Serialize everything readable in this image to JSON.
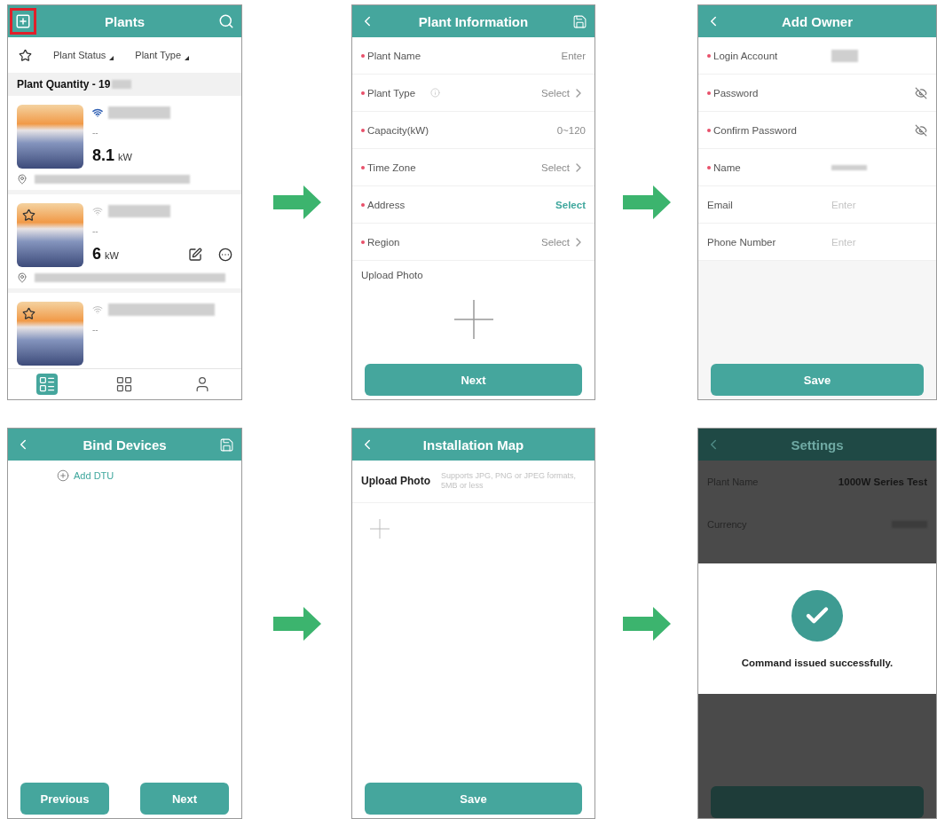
{
  "screens": [
    {
      "kind": "plant_list",
      "title": "Plants",
      "add_highlighted": true,
      "filters": [
        "Plant Status",
        "Plant Type"
      ],
      "quantity": "Plant Quantity - 19",
      "plants": [
        {
          "online": true,
          "favorite": false,
          "status": "--",
          "power": "8.1",
          "unit": "kW",
          "actions": false,
          "location": true
        },
        {
          "online": false,
          "favorite": true,
          "status": "--",
          "power": "6",
          "unit": "kW",
          "actions": true,
          "location": true
        },
        {
          "online": false,
          "favorite": true,
          "status": "--",
          "actions": false,
          "location": false
        }
      ],
      "nav": [
        {
          "selected": true
        },
        {
          "selected": false
        },
        {
          "selected": false
        }
      ]
    },
    {
      "kind": "form",
      "title": "Plant Information",
      "back": true,
      "save": true,
      "fields": [
        {
          "label": "Plant Name",
          "required": true,
          "placeholder": "Enter"
        },
        {
          "label": "Plant Type",
          "required": true,
          "info": true,
          "value": "Select",
          "chevron": true
        },
        {
          "label": "Capacity(kW)",
          "required": true,
          "placeholder": "0~120"
        },
        {
          "label": "Time Zone",
          "required": true,
          "value": "Select",
          "chevron": true
        },
        {
          "label": "Address",
          "required": true,
          "value": "Select",
          "accent": true
        },
        {
          "label": "Region",
          "required": true,
          "value": "Select",
          "chevron": true
        }
      ],
      "upload": "Upload Photo",
      "button": "Next"
    },
    {
      "kind": "owner_form",
      "title": "Add Owner",
      "back": true,
      "save": false,
      "fields": [
        {
          "label": "Login Account",
          "required": true,
          "redacted": true
        },
        {
          "label": "Password",
          "required": true,
          "eye": true
        },
        {
          "label": "Confirm Password",
          "required": true,
          "eye": true
        },
        {
          "label": "Name",
          "required": true,
          "redacted": true
        },
        {
          "label": "Email",
          "required": false,
          "placeholder": "Enter"
        },
        {
          "label": "Phone Number",
          "required": false,
          "placeholder": "Enter"
        }
      ],
      "button": "Save"
    },
    {
      "kind": "bind",
      "title": "Bind Devices",
      "back": true,
      "save": true,
      "link": "Add DTU",
      "buttons": [
        "Previous",
        "Next"
      ]
    },
    {
      "kind": "upload",
      "title": "Installation Map",
      "back": true,
      "save": false,
      "label": "Upload Photo",
      "hint": "Supports JPG, PNG or JPEG formats, 5MB or less",
      "button": "Save"
    },
    {
      "kind": "dialog",
      "title": "Settings",
      "back": true,
      "rows": [
        {
          "label": "Plant Name",
          "value": "1000W Series Test"
        },
        {
          "label": "Currency",
          "redacted": true
        }
      ],
      "message": "Command issued successfully."
    }
  ]
}
